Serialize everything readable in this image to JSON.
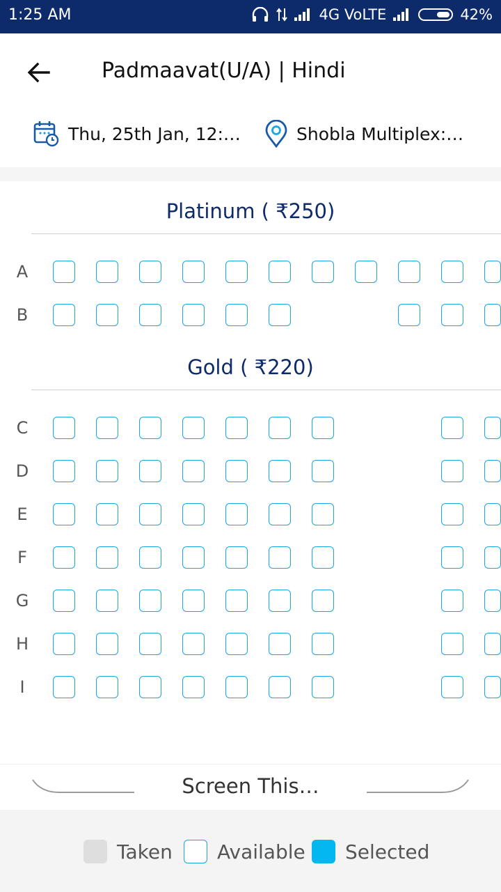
{
  "status": {
    "time": "1:25 AM",
    "network": "4G VoLTE",
    "battery": "42%"
  },
  "header": {
    "title": "Padmaavat(U/A) | Hindi",
    "date_text": "Thu, 25th Jan, 12:…",
    "venue_text": "Shobla Multiplex:…"
  },
  "sections": [
    {
      "label": "Platinum ( ₹250)",
      "rows": [
        "A",
        "B"
      ]
    },
    {
      "label": "Gold ( ₹220)",
      "rows": [
        "C",
        "D",
        "E",
        "F",
        "G",
        "H",
        "I"
      ]
    }
  ],
  "screen": {
    "label": "Screen This…"
  },
  "legend": {
    "taken": "Taken",
    "available": "Available",
    "selected": "Selected",
    "colors": {
      "taken": "#dedede",
      "available": "#1aa6e0",
      "selected": "#04b8ef"
    }
  },
  "colors": {
    "statusbar": "#0d2a6b",
    "section_title": "#0d2a6b",
    "seat_border": "#1aa6e0"
  },
  "icons": [
    "back-arrow-icon",
    "calendar-icon",
    "location-pin-icon",
    "headphones-icon",
    "signal-icon",
    "battery-icon"
  ]
}
